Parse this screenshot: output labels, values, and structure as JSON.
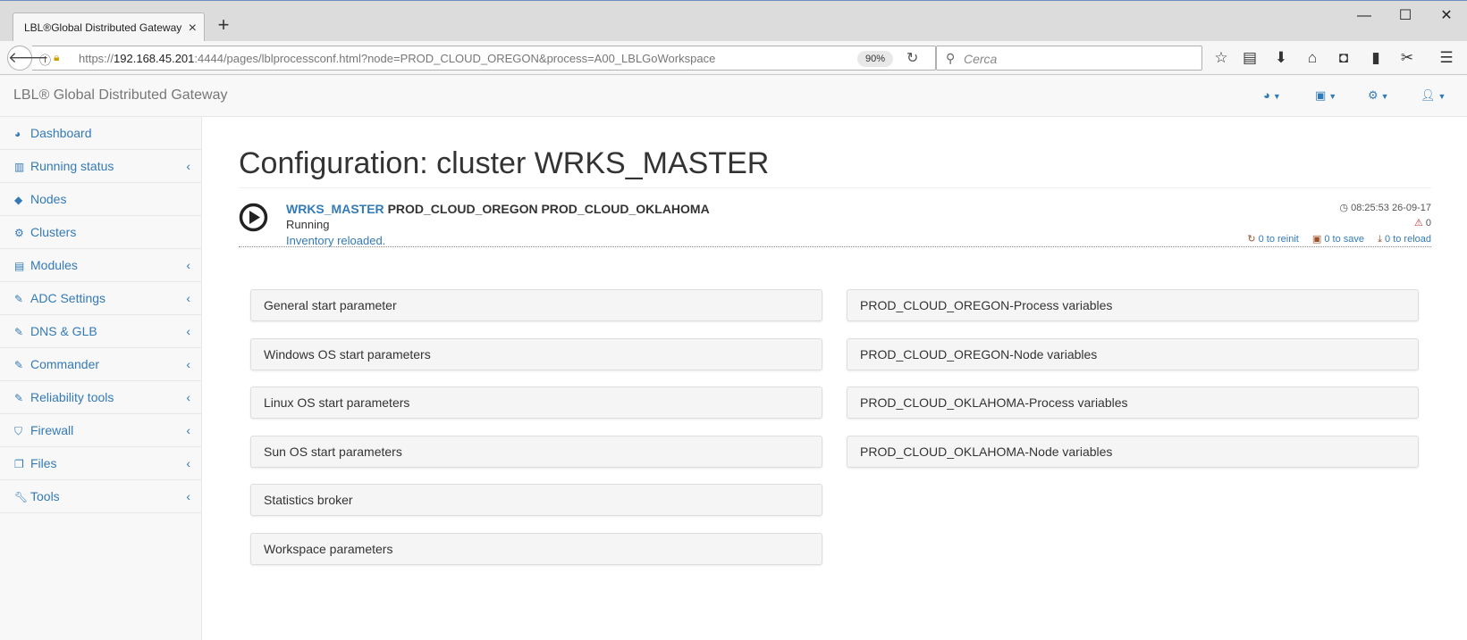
{
  "browser": {
    "tab_title": "LBL®Global Distributed Gateway",
    "tab_close": "×",
    "new_tab": "+",
    "win_min": "—",
    "win_max": "☐",
    "win_close": "✕",
    "url_prefix": "https://",
    "url_host": "192.168.45.201",
    "url_rest": ":4444/pages/lblprocessconf.html?node=PROD_CLOUD_OREGON&process=A00_LBLGoWorkspace",
    "zoom": "90%",
    "search_placeholder": "Cerca"
  },
  "header": {
    "brand": "LBL® Global Distributed Gateway"
  },
  "sidebar": {
    "items": [
      {
        "label": "Dashboard",
        "icon": "dashboard-icon",
        "expandable": false
      },
      {
        "label": "Running status",
        "icon": "bar-chart-icon",
        "expandable": true
      },
      {
        "label": "Nodes",
        "icon": "cube-icon",
        "expandable": false
      },
      {
        "label": "Clusters",
        "icon": "cogs-icon",
        "expandable": false
      },
      {
        "label": "Modules",
        "icon": "list-alt-icon",
        "expandable": true
      },
      {
        "label": "ADC Settings",
        "icon": "edit-icon",
        "expandable": true
      },
      {
        "label": "DNS & GLB",
        "icon": "edit-icon",
        "expandable": true
      },
      {
        "label": "Commander",
        "icon": "edit-icon",
        "expandable": true
      },
      {
        "label": "Reliability tools",
        "icon": "edit-icon",
        "expandable": true
      },
      {
        "label": "Firewall",
        "icon": "shield-icon",
        "expandable": true
      },
      {
        "label": "Files",
        "icon": "files-icon",
        "expandable": true
      },
      {
        "label": "Tools",
        "icon": "wrench-icon",
        "expandable": true
      }
    ]
  },
  "main": {
    "title": "Configuration: cluster WRKS_MASTER",
    "cluster_link": "WRKS_MASTER",
    "cluster_nodes": "PROD_CLOUD_OREGON PROD_CLOUD_OKLAHOMA",
    "status": "Running",
    "message": "Inventory reloaded.",
    "timestamp": "08:25:53 26-09-17",
    "warnings": "0",
    "reinit": "0 to reinit",
    "save": "0 to save",
    "reload": "0 to reload",
    "left_panels": [
      "General start parameter",
      "Windows OS start parameters",
      "Linux OS start parameters",
      "Sun OS start parameters",
      "Statistics broker",
      "Workspace parameters"
    ],
    "right_panels": [
      "PROD_CLOUD_OREGON-Process variables",
      "PROD_CLOUD_OREGON-Node variables",
      "PROD_CLOUD_OKLAHOMA-Process variables",
      "PROD_CLOUD_OKLAHOMA-Node variables"
    ]
  },
  "colors": {
    "link": "#337ab7",
    "warning": "#c9302c"
  }
}
